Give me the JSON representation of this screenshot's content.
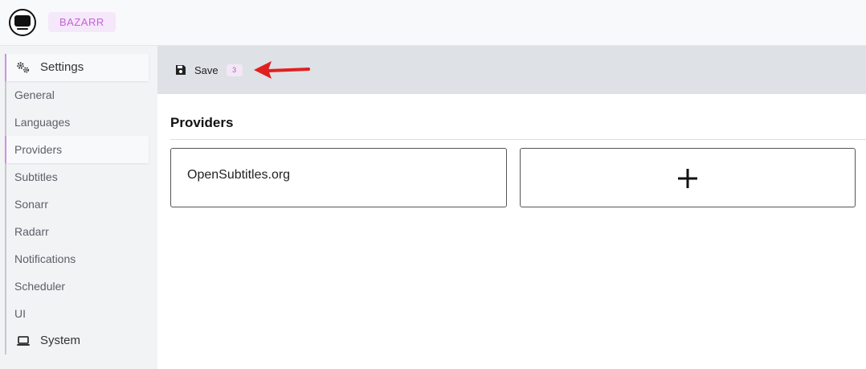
{
  "header": {
    "brand": "BAZARR",
    "logo_icon": "tv-icon"
  },
  "sidebar": {
    "settings_label": "Settings",
    "settings_icon": "gears-icon",
    "items": [
      {
        "label": "General"
      },
      {
        "label": "Languages"
      },
      {
        "label": "Providers",
        "active": true
      },
      {
        "label": "Subtitles"
      },
      {
        "label": "Sonarr"
      },
      {
        "label": "Radarr"
      },
      {
        "label": "Notifications"
      },
      {
        "label": "Scheduler"
      },
      {
        "label": "UI"
      }
    ],
    "system_label": "System",
    "system_icon": "laptop-icon"
  },
  "toolbar": {
    "save_label": "Save",
    "save_icon": "floppy-disk-icon",
    "pending_count": "3"
  },
  "annotation": {
    "arrow_color": "#e02020"
  },
  "main": {
    "title": "Providers",
    "providers": [
      {
        "name": "OpenSubtitles.org"
      }
    ],
    "add_icon": "plus-icon"
  },
  "colors": {
    "accent": "#c760d8",
    "toolbar_bg": "#dee1e6",
    "sidebar_bg": "#f1f3f5"
  }
}
